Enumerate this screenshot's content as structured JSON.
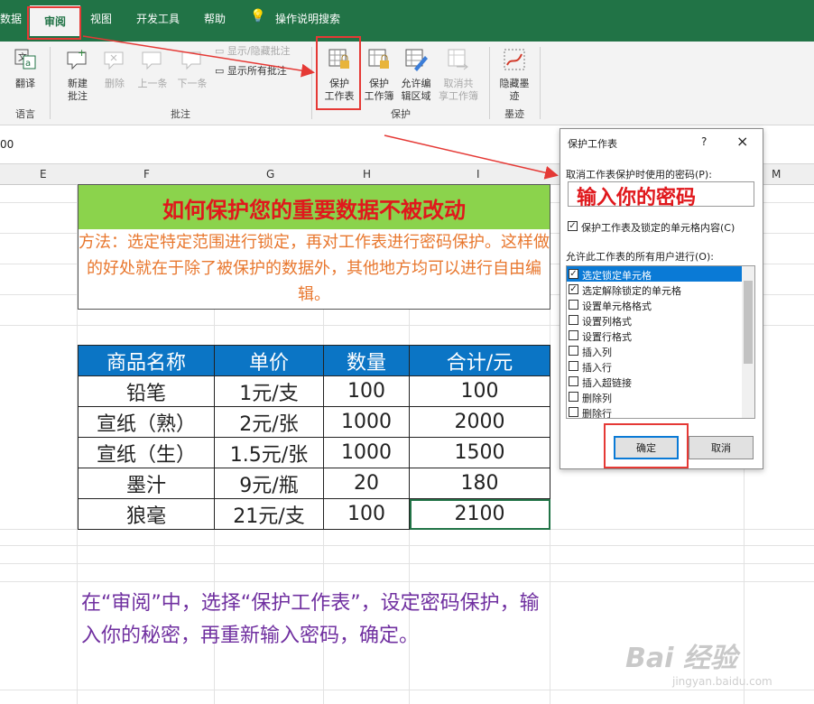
{
  "tabs": {
    "data": "数据",
    "review": "审阅",
    "view": "视图",
    "developer": "开发工具",
    "help": "帮助",
    "tell_me": "操作说明搜索"
  },
  "ribbon": {
    "translate": "翻译",
    "new_comment": "新建\n批注",
    "delete": "删除",
    "prev": "上一条",
    "next": "下一条",
    "show_hide_comment": "显示/隐藏批注",
    "show_all_comments": "显示所有批注",
    "protect_sheet": "保护\n工作表",
    "protect_workbook": "保护\n工作簿",
    "allow_edit_ranges": "允许编\n辑区域",
    "unshare_workbook": "取消共\n享工作簿",
    "hide_ink": "隐藏墨\n迹",
    "groups": {
      "language": "语言",
      "comments": "批注",
      "protect": "保护",
      "ink": "墨迹"
    }
  },
  "formula_bar": {
    "cell_ref_fragment": "00"
  },
  "columns": [
    "E",
    "F",
    "G",
    "H",
    "I",
    "M"
  ],
  "sheet": {
    "title": "如何保护您的重要数据不被改动",
    "method": "方法：选定特定范围进行锁定，再对工作表进行密码保护。这样做的好处就在于除了被保护的数据外，其他地方均可以进行自由编辑。",
    "table": {
      "headers": [
        "商品名称",
        "单价",
        "数量",
        "合计/元"
      ],
      "rows": [
        [
          "铅笔",
          "1元/支",
          "100",
          "100"
        ],
        [
          "宣纸（熟）",
          "2元/张",
          "1000",
          "2000"
        ],
        [
          "宣纸（生）",
          "1.5元/张",
          "1000",
          "1500"
        ],
        [
          "墨汁",
          "9元/瓶",
          "20",
          "180"
        ],
        [
          "狼毫",
          "21元/支",
          "100",
          "2100"
        ]
      ]
    },
    "note": "在“审阅”中，选择“保护工作表”，设定密码保护，输入你的秘密，再重新输入密码，确定。"
  },
  "dialog": {
    "title": "保护工作表",
    "help": "?",
    "close": "×",
    "password_label": "取消工作表保护时使用的密码(P):",
    "password_hint": "输入你的密码",
    "protect_label": "保护工作表及锁定的单元格内容(C)",
    "protect_checked": true,
    "allow_label": "允许此工作表的所有用户进行(O):",
    "options": [
      {
        "label": "选定锁定单元格",
        "checked": true
      },
      {
        "label": "选定解除锁定的单元格",
        "checked": true
      },
      {
        "label": "设置单元格格式",
        "checked": false
      },
      {
        "label": "设置列格式",
        "checked": false
      },
      {
        "label": "设置行格式",
        "checked": false
      },
      {
        "label": "插入列",
        "checked": false
      },
      {
        "label": "插入行",
        "checked": false
      },
      {
        "label": "插入超链接",
        "checked": false
      },
      {
        "label": "删除列",
        "checked": false
      },
      {
        "label": "删除行",
        "checked": false
      }
    ],
    "ok": "确定",
    "cancel": "取消"
  },
  "watermark": {
    "logo": "Bai 经验",
    "url": "jingyan.baidu.com"
  },
  "colors": {
    "accent": "#217346",
    "highlight": "#e53935",
    "header_blue": "#0b75c5",
    "title_green": "#8bd34c"
  }
}
